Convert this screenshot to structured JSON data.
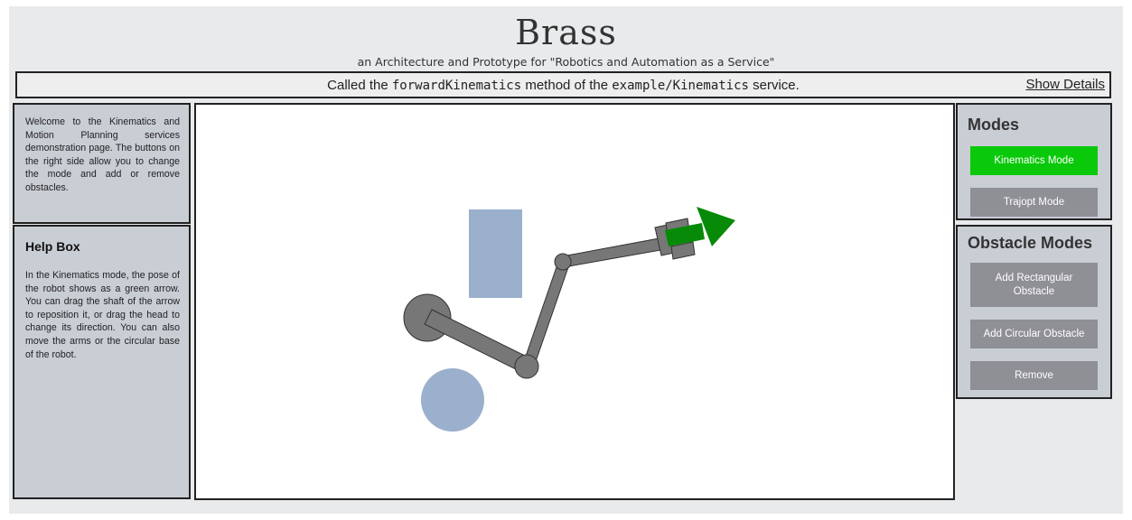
{
  "header": {
    "title": "Brass",
    "subtitle": "an Architecture and Prototype for \"Robotics and Automation as a Service\""
  },
  "status": {
    "prefix": "Called the",
    "method": "forwardKinematics",
    "middle": "method of the",
    "service": "example/Kinematics",
    "suffix": "service.",
    "show_details": "Show Details"
  },
  "welcome": {
    "text": "Welcome to the Kinematics and Motion Planning services demonstration page. The buttons on the right side allow you to change the mode and add or remove obstacles."
  },
  "help": {
    "title": "Help Box",
    "text": "In the Kinematics mode, the pose of the robot shows as a green arrow. You can drag the shaft of the arrow to reposition it, or drag the head to change its direction. You can also move the arms or the circular base of the robot."
  },
  "modes": {
    "title": "Modes",
    "kinematics": "Kinematics Mode",
    "trajopt": "Trajopt Mode"
  },
  "obstacle_modes": {
    "title": "Obstacle Modes",
    "add_rect": "Add Rectangular Obstacle",
    "add_circ": "Add Circular Obstacle",
    "remove": "Remove"
  },
  "colors": {
    "active_button": "#0ac90a",
    "inactive_button": "#8f8f96",
    "obstacle": "#9ab0cc",
    "robot": "#777777",
    "pose_arrow": "#078a07"
  }
}
